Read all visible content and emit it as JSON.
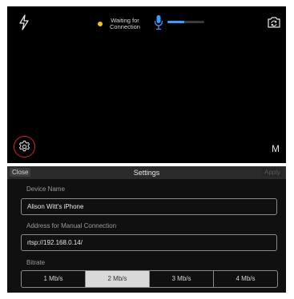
{
  "camera": {
    "flash_icon": "flash-icon",
    "status_text": "Waiting for\nConnection",
    "status_color": "#f5c211",
    "mic_icon": "mic-icon",
    "audio_level": 0.45,
    "camera_switch_icon": "camera-switch-icon",
    "settings_icon": "gear-icon",
    "mode_label": "M"
  },
  "settings": {
    "close_label": "Close",
    "title": "Settings",
    "apply_label": "Apply",
    "device_name_label": "Device Name",
    "device_name_value": "Alison Witt's iPhone",
    "address_label": "Address for Manual Connection",
    "address_value": "rtsp://192.168.0.14/",
    "bitrate_label": "Bitrate",
    "bitrate_options": [
      "1 Mb/s",
      "2 Mb/s",
      "3 Mb/s",
      "4 Mb/s"
    ],
    "bitrate_selected": "2 Mb/s"
  }
}
